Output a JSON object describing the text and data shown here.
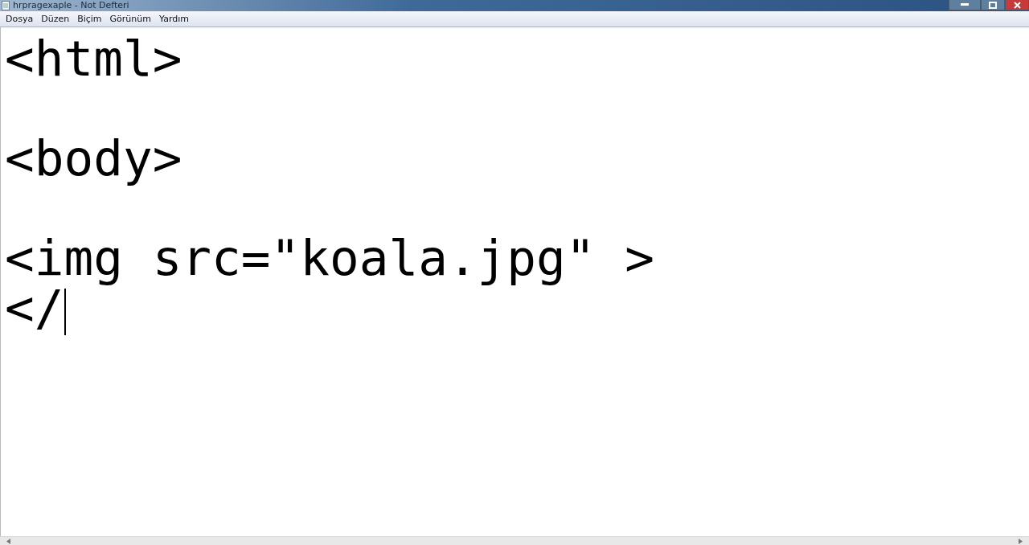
{
  "window": {
    "title": "hrpragexaple - Not Defteri"
  },
  "menu": [
    "Dosya",
    "Düzen",
    "Biçim",
    "Görünüm",
    "Yardım"
  ],
  "editor": {
    "text": "<html>\n\n<body>\n\n<img src=\"koala.jpg\" >\n</"
  }
}
